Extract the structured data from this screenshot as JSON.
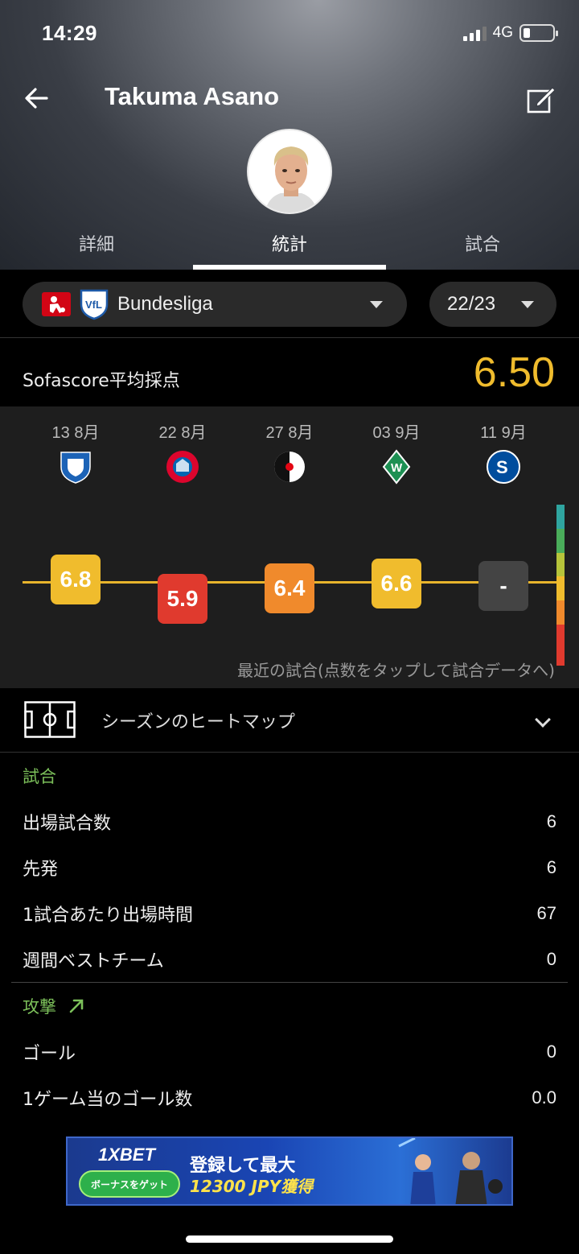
{
  "status_bar": {
    "time": "14:29",
    "network": "4G"
  },
  "header": {
    "title": "Takuma Asano"
  },
  "tabs": [
    {
      "label": "詳細",
      "active": false
    },
    {
      "label": "統計",
      "active": true
    },
    {
      "label": "試合",
      "active": false
    }
  ],
  "filters": {
    "league": "Bundesliga",
    "season": "22/23"
  },
  "rating": {
    "label": "Sofascore平均採点",
    "value": "6.50",
    "color": "#f0bc2d"
  },
  "matches": [
    {
      "date": "13 8月",
      "team": "hoffenheim-icon",
      "score": "6.8",
      "color": "#f0bc2d"
    },
    {
      "date": "22 8月",
      "team": "bayern-icon",
      "score": "5.9",
      "color": "#e03a2e"
    },
    {
      "date": "27 8月",
      "team": "freiburg-icon",
      "score": "6.4",
      "color": "#f08a2c"
    },
    {
      "date": "03 9月",
      "team": "werder-icon",
      "score": "6.6",
      "color": "#f0bc2d"
    },
    {
      "date": "11 9月",
      "team": "schalke-icon",
      "score": "-",
      "color": "#444444"
    }
  ],
  "chart_note": "最近の試合(点数をタップして試合データへ)",
  "heatmap": {
    "label": "シーズンのヒートマップ"
  },
  "sections": {
    "matches": {
      "title": "試合",
      "rows": [
        {
          "label": "出場試合数",
          "value": "6"
        },
        {
          "label": "先発",
          "value": "6"
        },
        {
          "label": "1試合あたり出場時間",
          "value": "67"
        },
        {
          "label": "週間ベストチーム",
          "value": "0"
        }
      ]
    },
    "attack": {
      "title": "攻撃",
      "rows": [
        {
          "label": "ゴール",
          "value": "0"
        },
        {
          "label": "1ゲーム当のゴール数",
          "value": "0.0"
        }
      ]
    }
  },
  "ad": {
    "brand": "1XBET",
    "button": "ボーナスをゲット",
    "line1": "登録して最大",
    "line2": "12300 JPY獲得"
  }
}
